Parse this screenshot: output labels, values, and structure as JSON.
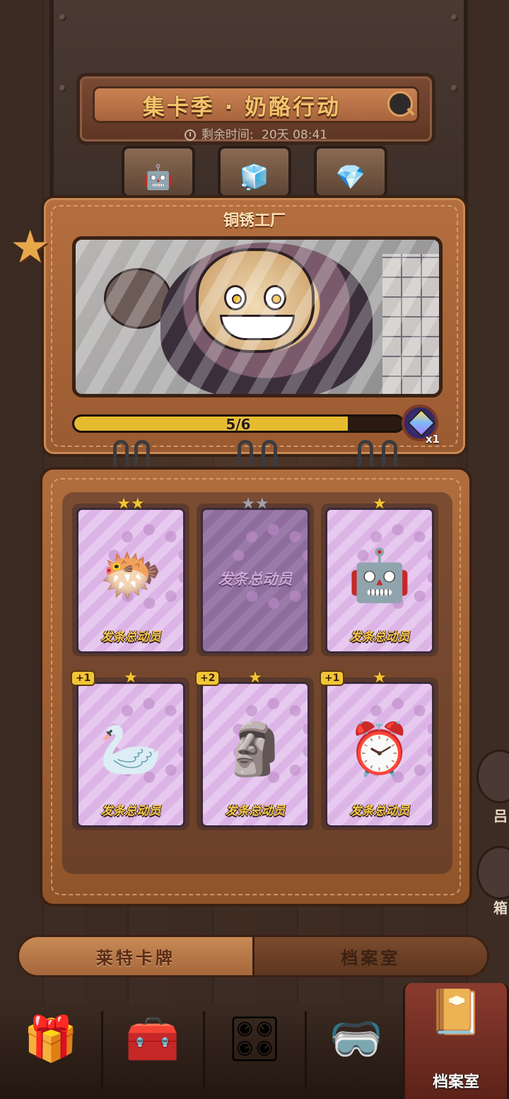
{
  "header": {
    "title": "集卡季 · 奶酪行动",
    "timer_label": "剩余时间:",
    "timer_value": "20天 08:41"
  },
  "top_icons": [
    "robot-face-icon",
    "cube-icon",
    "gem-icon"
  ],
  "album": {
    "title": "铜锈工厂",
    "progress_text": "5/6",
    "progress_current": 5,
    "progress_total": 6,
    "reward_count": "x1",
    "reward_icon": "rainbow-cube-icon"
  },
  "cards": [
    {
      "name": "发条总动员",
      "stars": 2,
      "owned": true,
      "plus": "",
      "art": "pink-blimp-character"
    },
    {
      "name": "发条总动员",
      "stars": 2,
      "owned": false,
      "plus": "",
      "art": ""
    },
    {
      "name": "发条总动员",
      "stars": 1,
      "owned": true,
      "plus": "",
      "art": "blue-robot-character"
    },
    {
      "name": "发条总动员",
      "stars": 1,
      "owned": true,
      "plus": "+1",
      "art": "pelican-character"
    },
    {
      "name": "发条总动员",
      "stars": 1,
      "owned": true,
      "plus": "+2",
      "art": "cannon-character"
    },
    {
      "name": "发条总动员",
      "stars": 1,
      "owned": true,
      "plus": "+1",
      "art": "dynamite-clock-character"
    }
  ],
  "tabs": {
    "cards": "莱特卡牌",
    "archive": "档案室"
  },
  "side": {
    "label_1": "吕",
    "label_2": "箱"
  },
  "bottom_nav": {
    "items": [
      "star-chest-icon",
      "lunchbox-icon",
      "control-panel-icon",
      "goggles-chest-icon",
      "archive-book-icon"
    ],
    "active_label": "档案室"
  },
  "colors": {
    "progress_fill": "#e6bb2f",
    "star": "#f2c536",
    "card_bg": "#e3c2ec",
    "accent_text": "#f3c46a"
  }
}
